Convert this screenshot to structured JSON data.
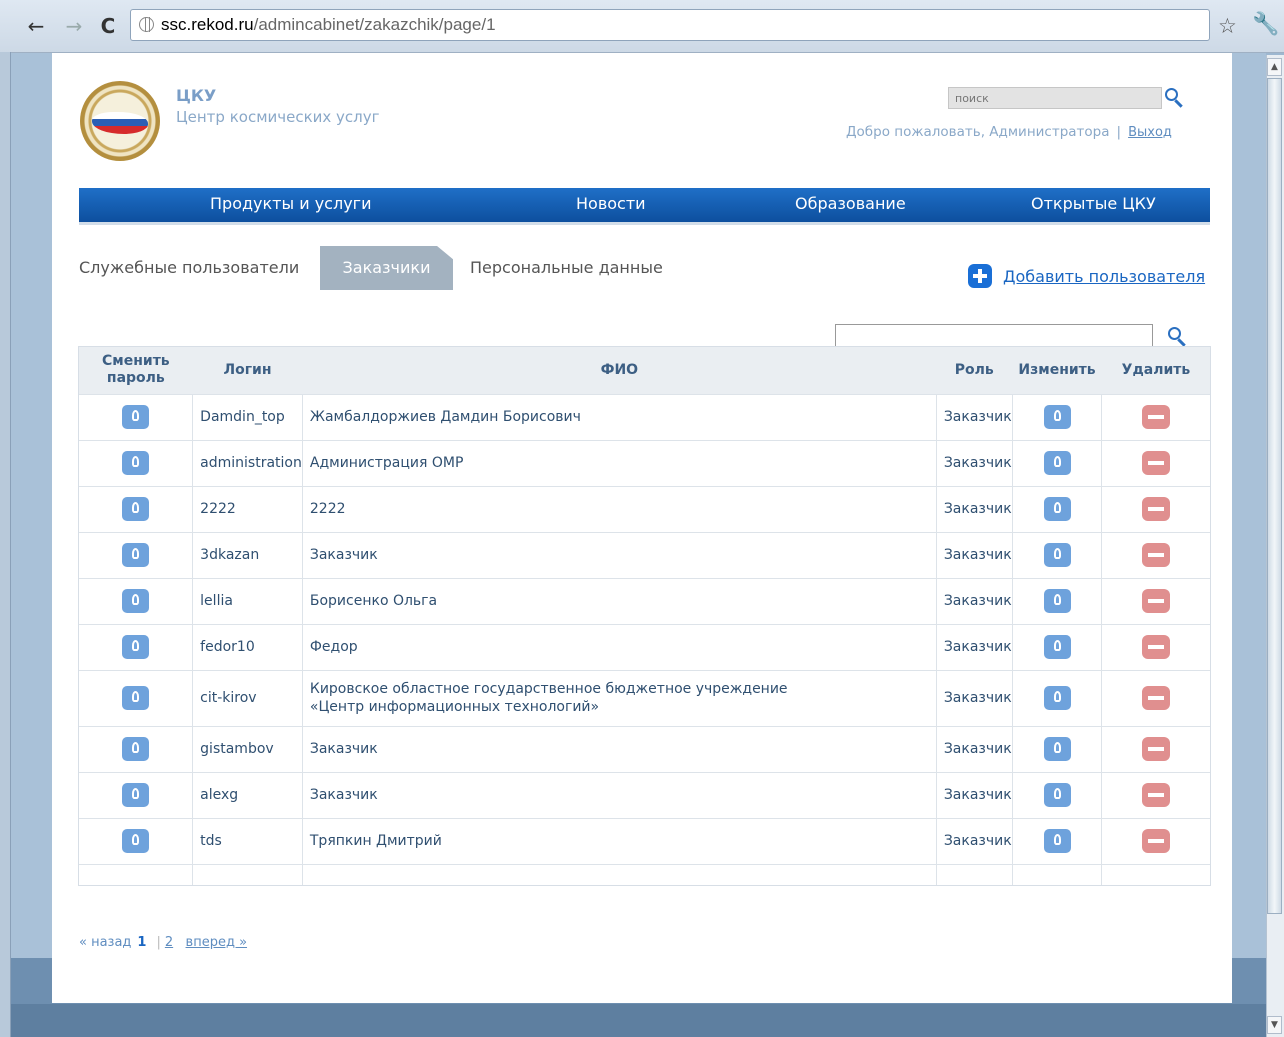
{
  "browser": {
    "back_icon": "arrow-left-icon",
    "forward_icon": "arrow-right-icon",
    "reload_icon": "reload-icon",
    "url_host": "ssc.rekod.ru",
    "url_path": "/admincabinet/zakazchik/page/1"
  },
  "header": {
    "brand_title": "ЦКУ",
    "brand_subtitle": "Центр космических услуг",
    "search_placeholder": "поиск",
    "welcome_text": "Добро пожаловать, Администратора",
    "separator": "|",
    "logout_label": "Выход"
  },
  "nav": {
    "items": [
      "Продукты и услуги",
      "Новости",
      "Образование",
      "Открытые ЦКУ"
    ],
    "color": "#1264b8"
  },
  "tabs": {
    "service_users": "Служебные пользователи",
    "customers": "Заказчики",
    "personal_data": "Персональные данные"
  },
  "actions": {
    "add_user": "Добавить пользователя"
  },
  "table": {
    "columns": {
      "change_password": "Сменить пароль",
      "login": "Логин",
      "full_name": "ФИО",
      "role": "Роль",
      "edit": "Изменить",
      "delete": "Удалить"
    },
    "rows": [
      {
        "login": "Damdin_top",
        "name": "Жамбалдоржиев Дамдин Борисович",
        "role": "Заказчик"
      },
      {
        "login": "administration",
        "name": "Администрация ОМР",
        "role": "Заказчик"
      },
      {
        "login": "2222",
        "name": "2222",
        "role": "Заказчик"
      },
      {
        "login": "3dkazan",
        "name": "Заказчик",
        "role": "Заказчик"
      },
      {
        "login": "lellia",
        "name": "Борисенко Ольга",
        "role": "Заказчик"
      },
      {
        "login": "fedor10",
        "name": "Федор",
        "role": "Заказчик"
      },
      {
        "login": "cit-kirov",
        "name": "Кировское областное государственное бюджетное учреждение «Центр информационных технологий»",
        "role": "Заказчик"
      },
      {
        "login": "gistambov",
        "name": "Заказчик",
        "role": "Заказчик"
      },
      {
        "login": "alexg",
        "name": "Заказчик",
        "role": "Заказчик"
      },
      {
        "login": "tds",
        "name": "Тряпкин Дмитрий",
        "role": "Заказчик"
      }
    ]
  },
  "pagination": {
    "prev_label": "« назад",
    "current_page": "1",
    "separator": "|",
    "next_page": "2",
    "next_label": "вперед »"
  },
  "colors": {
    "accent": "#1a66c2",
    "nav_blue": "#1264b8",
    "edit_icon": "#6ea2dc",
    "delete_icon": "#e08f8f",
    "active_tab": "#a3b2c0"
  }
}
